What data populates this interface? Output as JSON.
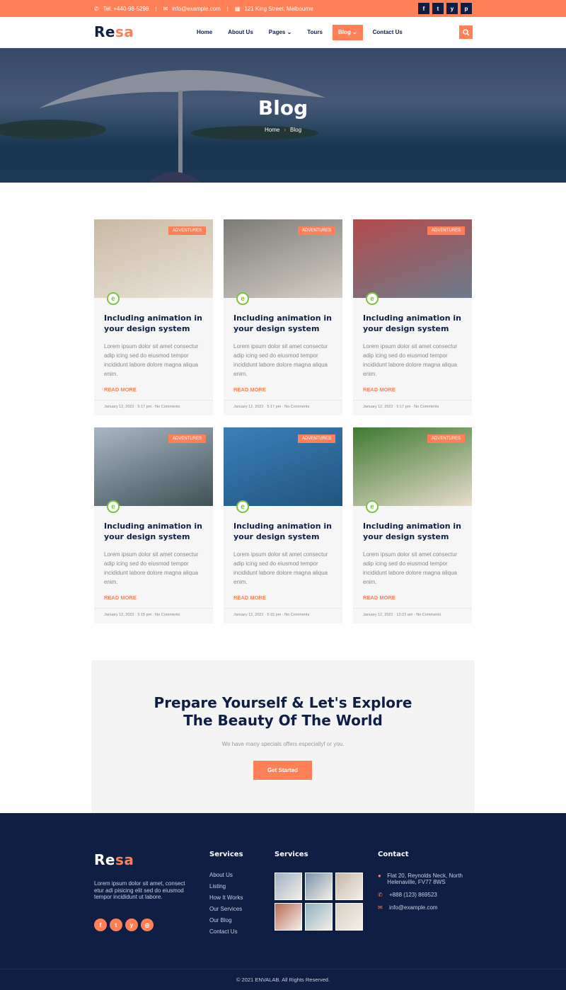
{
  "topbar": {
    "phone": "Tel: +440-98-5298",
    "email": "info@example.com",
    "address": "121 King Street, Melbourne",
    "social": [
      "f",
      "t",
      "y",
      "p"
    ]
  },
  "brand": {
    "logo_main": "Re",
    "logo_accent": "sa"
  },
  "nav": {
    "items": [
      {
        "label": "Home"
      },
      {
        "label": "About Us"
      },
      {
        "label": "Pages ⌄"
      },
      {
        "label": "Tours"
      },
      {
        "label": "Blog ⌄"
      },
      {
        "label": "Contact Us"
      }
    ],
    "active": "Blog"
  },
  "hero": {
    "title": "Blog",
    "crumb_home": "Home",
    "crumb_arrow": "›",
    "crumb_current": "Blog"
  },
  "posts": [
    {
      "tag": "ADVENTURES",
      "title": "Including animation in your design system",
      "excerpt": "Lorem ipsum dolor sit amet consectur adip icing sed do eiusmod tempor incididunt labore dolore magna aliqua enim.",
      "more": "READ MORE",
      "date": "January 12, 2022",
      "time": "5:17 pm",
      "comments": "No Comments",
      "img_colors": [
        "#c9b9a3",
        "#e9e3d8"
      ]
    },
    {
      "tag": "ADVENTURES",
      "title": "Including animation in your design system",
      "excerpt": "Lorem ipsum dolor sit amet consectur adip icing sed do eiusmod tempor incididunt labore dolore magna aliqua enim.",
      "more": "READ MORE",
      "date": "January 12, 2022",
      "time": "5:17 pm",
      "comments": "No Comments",
      "img_colors": [
        "#7d7b76",
        "#d4cfc6"
      ]
    },
    {
      "tag": "ADVENTURES",
      "title": "Including animation in your design system",
      "excerpt": "Lorem ipsum dolor sit amet consectur adip icing sed do eiusmod tempor incididunt labore dolore magna aliqua enim.",
      "more": "READ MORE",
      "date": "January 12, 2022",
      "time": "5:17 pm",
      "comments": "No Comments",
      "img_colors": [
        "#b34b4a",
        "#6d7b8c"
      ]
    },
    {
      "tag": "ADVENTURES",
      "title": "Including animation in your design system",
      "excerpt": "Lorem ipsum dolor sit amet consectur adip icing sed do eiusmod tempor incididunt labore dolore magna aliqua enim.",
      "more": "READ MORE",
      "date": "January 12, 2022",
      "time": "5:15 pm",
      "comments": "No Comments",
      "img_colors": [
        "#a9b7c5",
        "#3f5156"
      ]
    },
    {
      "tag": "ADVENTURES",
      "title": "Including animation in your design system",
      "excerpt": "Lorem ipsum dolor sit amet consectur adip icing sed do eiusmod tempor incididunt labore dolore magna aliqua enim.",
      "more": "READ MORE",
      "date": "January 12, 2022",
      "time": "5:15 pm",
      "comments": "No Comments",
      "img_colors": [
        "#3d7fb8",
        "#20557f"
      ]
    },
    {
      "tag": "ADVENTURES",
      "title": "Including animation in your design system",
      "excerpt": "Lorem ipsum dolor sit amet consectur adip icing sed do eiusmod tempor incididunt labore dolore magna aliqua enim.",
      "more": "READ MORE",
      "date": "January 12, 2022",
      "time": "12:23 am",
      "comments": "No Comments",
      "img_colors": [
        "#3f7a33",
        "#e7dccb"
      ]
    }
  ],
  "cta": {
    "title_line1": "Prepare Yourself & Let's Explore",
    "title_line2": "The Beauty Of The World",
    "subtitle": "We have many specials offers especiallyf or you.",
    "button": "Get Started"
  },
  "footer": {
    "about": "Lorem ipsum dolor sit amet, consect etur adi pisicing elit sed do eiusmod tempor incididunt ut labore.",
    "social": [
      "f",
      "t",
      "y",
      "◎"
    ],
    "services_title": "Services",
    "links": [
      "About Us",
      "Listing",
      "How It Works",
      "Our Services",
      "Our Blog",
      "Contact Us"
    ],
    "gallery_title": "Services",
    "gallery_colors": [
      "#9fb1c4",
      "#7b93a8",
      "#c8b7a6",
      "#b96b57",
      "#8eb2c2",
      "#d8cfc4"
    ],
    "contact_title": "Contact",
    "address": "Flat 20, Reynolds Neck, North Helenaville, FV77 8WS",
    "phone": "+888 (123) 869523",
    "email": "info@example.com",
    "copyright": "© 2021 ENVALAB. All Rights Reserved."
  },
  "colors": {
    "accent": "#ff7f57",
    "navy": "#0f1f44"
  }
}
